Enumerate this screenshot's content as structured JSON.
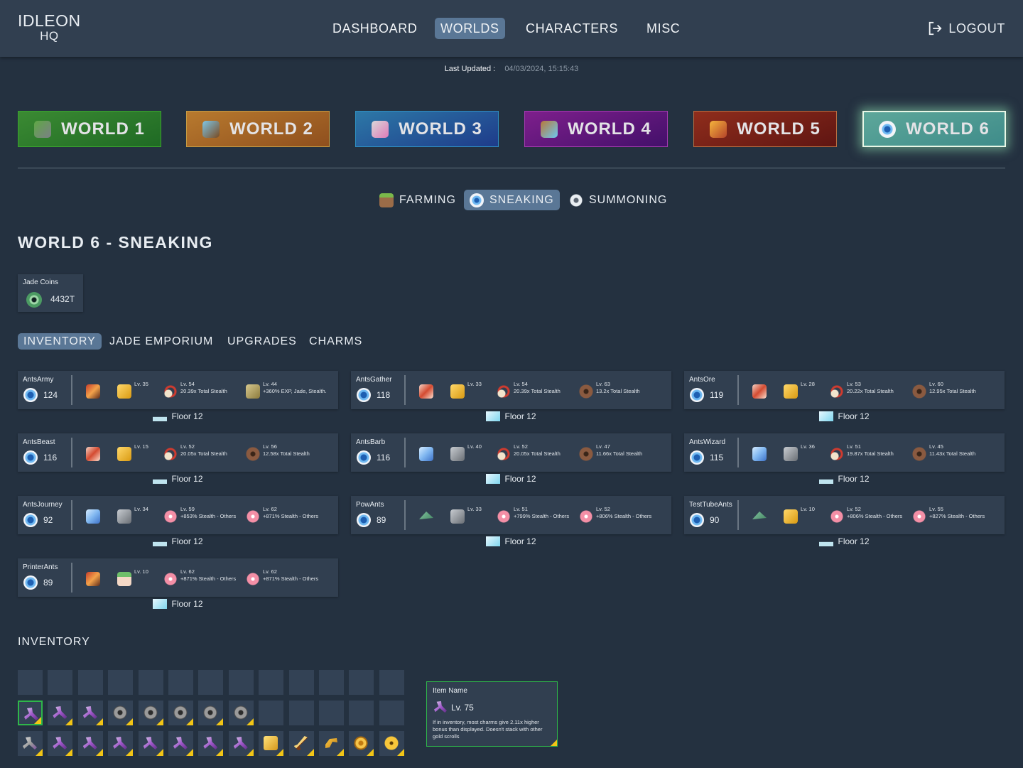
{
  "header": {
    "logo_line1": "IDLEON",
    "logo_line2": "HQ",
    "nav": [
      {
        "label": "DASHBOARD",
        "active": false
      },
      {
        "label": "WORLDS",
        "active": true
      },
      {
        "label": "CHARACTERS",
        "active": false
      },
      {
        "label": "MISC",
        "active": false
      }
    ],
    "logout_label": "LOGOUT"
  },
  "last_updated": {
    "label": "Last Updated :",
    "value": "04/03/2024, 15:15:43"
  },
  "worlds": [
    {
      "label": "WORLD 1",
      "icon": "anvil-tree-icon"
    },
    {
      "label": "WORLD 2",
      "icon": "alchemy-icon"
    },
    {
      "label": "WORLD 3",
      "icon": "skull-saw-icon"
    },
    {
      "label": "WORLD 4",
      "icon": "lab-flask-icon"
    },
    {
      "label": "WORLD 5",
      "icon": "sprout-icon"
    },
    {
      "label": "WORLD 6",
      "icon": "sneaking-eye-icon",
      "active": true
    }
  ],
  "subtabs": [
    {
      "label": "FARMING",
      "icon": "farming-icon",
      "active": false
    },
    {
      "label": "SNEAKING",
      "icon": "sneaking-icon",
      "active": true
    },
    {
      "label": "SUMMONING",
      "icon": "summoning-icon",
      "active": false
    }
  ],
  "page_title": "WORLD 6 - SNEAKING",
  "jade_coins": {
    "label": "Jade Coins",
    "value": "4432T"
  },
  "section_tabs": [
    {
      "label": "INVENTORY",
      "active": true
    },
    {
      "label": "JADE EMPORIUM",
      "active": false
    },
    {
      "label": "UPGRADES",
      "active": false
    },
    {
      "label": "CHARMS",
      "active": false
    }
  ],
  "ninjas": [
    {
      "name": "AntsArmy",
      "level": "124",
      "floor": "Floor 12",
      "floor_icon": "sleeping-icon",
      "gear": [
        {
          "icon": "mask-icon",
          "lv": "",
          "desc": ""
        },
        {
          "icon": "gold-glove-icon",
          "lv": "Lv. 35",
          "desc": ""
        },
        {
          "icon": "pearl-necklace-icon",
          "lv": "Lv. 54",
          "desc": "20.39x Total Stealth"
        },
        {
          "icon": "scroll-icon",
          "lv": "Lv. 44",
          "desc": "+360% EXP, Jade, Stealth."
        }
      ]
    },
    {
      "name": "AntsGather",
      "level": "118",
      "floor": "Floor 12",
      "floor_icon": "running-icon",
      "gear": [
        {
          "icon": "wings-icon",
          "lv": "",
          "desc": ""
        },
        {
          "icon": "gold-glove-icon",
          "lv": "Lv. 33",
          "desc": ""
        },
        {
          "icon": "pearl-necklace-icon",
          "lv": "Lv. 54",
          "desc": "20.39x Total Stealth"
        },
        {
          "icon": "belt-icon",
          "lv": "Lv. 63",
          "desc": "13.2x Total Stealth"
        }
      ]
    },
    {
      "name": "AntsOre",
      "level": "119",
      "floor": "Floor 12",
      "floor_icon": "running-icon",
      "gear": [
        {
          "icon": "wings-icon",
          "lv": "",
          "desc": ""
        },
        {
          "icon": "gold-glove-icon",
          "lv": "Lv. 28",
          "desc": ""
        },
        {
          "icon": "pearl-necklace-icon",
          "lv": "Lv. 53",
          "desc": "20.22x Total Stealth"
        },
        {
          "icon": "belt-icon",
          "lv": "Lv. 60",
          "desc": "12.95x Total Stealth"
        }
      ]
    },
    {
      "name": "AntsBeast",
      "level": "116",
      "floor": "Floor 12",
      "floor_icon": "sleeping-icon",
      "gear": [
        {
          "icon": "wings-icon",
          "lv": "",
          "desc": ""
        },
        {
          "icon": "gold-glove-icon",
          "lv": "Lv. 15",
          "desc": ""
        },
        {
          "icon": "pearl-necklace-icon",
          "lv": "Lv. 52",
          "desc": "20.05x Total Stealth"
        },
        {
          "icon": "belt-icon",
          "lv": "Lv. 56",
          "desc": "12.58x Total Stealth"
        }
      ]
    },
    {
      "name": "AntsBarb",
      "level": "116",
      "floor": "Floor 12",
      "floor_icon": "running-icon",
      "gear": [
        {
          "icon": "ice-wings-icon",
          "lv": "",
          "desc": ""
        },
        {
          "icon": "stone-glove-icon",
          "lv": "Lv. 40",
          "desc": ""
        },
        {
          "icon": "pearl-necklace-icon",
          "lv": "Lv. 52",
          "desc": "20.05x Total Stealth"
        },
        {
          "icon": "belt-icon",
          "lv": "Lv. 47",
          "desc": "11.66x Total Stealth"
        }
      ]
    },
    {
      "name": "AntsWizard",
      "level": "115",
      "floor": "Floor 12",
      "floor_icon": "sleeping-icon",
      "gear": [
        {
          "icon": "ice-wings-icon",
          "lv": "",
          "desc": ""
        },
        {
          "icon": "stone-glove-icon",
          "lv": "Lv. 36",
          "desc": ""
        },
        {
          "icon": "pearl-necklace-icon",
          "lv": "Lv. 51",
          "desc": "19.87x Total Stealth"
        },
        {
          "icon": "belt-icon",
          "lv": "Lv. 45",
          "desc": "11.43x Total Stealth"
        }
      ]
    },
    {
      "name": "AntsJourney",
      "level": "92",
      "floor": "Floor 12",
      "floor_icon": "sleeping-icon",
      "gear": [
        {
          "icon": "ice-wings-icon",
          "lv": "",
          "desc": ""
        },
        {
          "icon": "stone-glove-icon",
          "lv": "Lv. 34",
          "desc": ""
        },
        {
          "icon": "lotus-icon",
          "lv": "Lv. 59",
          "desc": "+853% Stealth - Others"
        },
        {
          "icon": "lotus-icon",
          "lv": "Lv. 62",
          "desc": "+871% Stealth - Others"
        }
      ]
    },
    {
      "name": "PowAnts",
      "level": "89",
      "floor": "Floor 12",
      "floor_icon": "running-icon",
      "gear": [
        {
          "icon": "kite-icon",
          "lv": "",
          "desc": ""
        },
        {
          "icon": "stone-glove-icon",
          "lv": "Lv. 33",
          "desc": ""
        },
        {
          "icon": "lotus-icon",
          "lv": "Lv. 51",
          "desc": "+799% Stealth - Others"
        },
        {
          "icon": "lotus-icon",
          "lv": "Lv. 52",
          "desc": "+806% Stealth - Others"
        }
      ]
    },
    {
      "name": "TestTubeAnts",
      "level": "90",
      "floor": "Floor 12",
      "floor_icon": "sleeping-icon",
      "gear": [
        {
          "icon": "kite-icon",
          "lv": "",
          "desc": ""
        },
        {
          "icon": "gold-glove-icon",
          "lv": "Lv. 10",
          "desc": ""
        },
        {
          "icon": "lotus-icon",
          "lv": "Lv. 52",
          "desc": "+806% Stealth - Others"
        },
        {
          "icon": "lotus-icon",
          "lv": "Lv. 55",
          "desc": "+827% Stealth - Others"
        }
      ]
    },
    {
      "name": "PrinterAnts",
      "level": "89",
      "floor": "Floor 12",
      "floor_icon": "running-icon",
      "gear": [
        {
          "icon": "mask-icon",
          "lv": "",
          "desc": ""
        },
        {
          "icon": "flower-dress-icon",
          "lv": "Lv. 10",
          "desc": ""
        },
        {
          "icon": "lotus-icon",
          "lv": "Lv. 62",
          "desc": "+871% Stealth - Others"
        },
        {
          "icon": "lotus-icon",
          "lv": "Lv. 62",
          "desc": "+871% Stealth - Others"
        }
      ]
    }
  ],
  "inventory": {
    "title": "INVENTORY",
    "rows": [
      [
        "",
        "",
        "",
        "",
        "",
        "",
        "",
        "",
        "",
        "",
        "",
        "",
        ""
      ],
      [
        "pickaxe-charm-icon",
        "pickaxe-charm-icon",
        "pickaxe-charm-icon",
        "ring-charm-icon",
        "ring-charm-icon",
        "ring-charm-icon",
        "ring-charm-icon",
        "ring-charm-icon",
        "",
        "",
        "",
        "",
        ""
      ],
      [
        "silver-pickaxe-charm-icon",
        "pickaxe-charm-icon",
        "pickaxe-charm-icon",
        "pickaxe-charm-icon",
        "pickaxe-charm-icon",
        "pickaxe-charm-icon",
        "pickaxe-charm-icon",
        "pickaxe-charm-icon",
        "gold-scroll-icon",
        "gold-sword-icon",
        "gold-horn-icon",
        "gold-coin-icon",
        "gold-eye-icon"
      ]
    ],
    "selected": [
      1,
      0
    ]
  },
  "tooltip": {
    "title": "Item Name",
    "level": "Lv. 75",
    "description": "If in inventory, most charms give 2.11x higher bonus than displayed. Doesn't stack with other gold scrolls"
  }
}
